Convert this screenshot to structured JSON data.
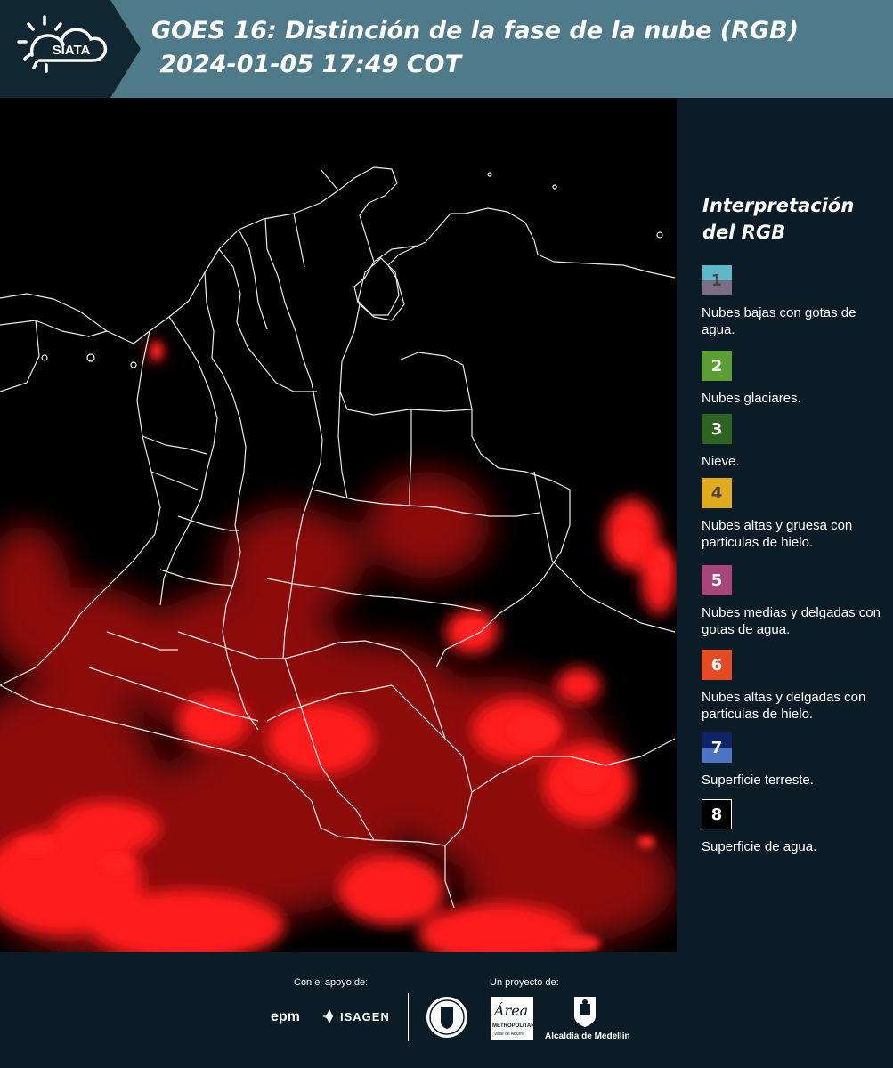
{
  "header": {
    "logo_text": "SIATA",
    "title_line1": "GOES 16: Distinción de la fase de la nube (RGB)",
    "title_line2": " 2024-01-05 17:49 COT",
    "bg_color": "#4e7a8a"
  },
  "legend": {
    "title_line1": "Interpretación",
    "title_line2": "del RGB",
    "items": [
      {
        "num": "1",
        "label": "Nubes bajas con gotas de agua.",
        "color_top": "#5fb8c8",
        "color_bottom": "#7a6e86",
        "num_color": "#444444"
      },
      {
        "num": "2",
        "label": "Nubes glaciares.",
        "color_top": "#5a9e34",
        "color_bottom": "#5a9e34",
        "num_color": "#ffffff"
      },
      {
        "num": "3",
        "label": "Nieve.",
        "color_top": "#2f6321",
        "color_bottom": "#2f6321",
        "num_color": "#ffffff"
      },
      {
        "num": "4",
        "label": "Nubes altas y gruesa con particulas de hielo.",
        "color_top": "#e0ac1c",
        "color_bottom": "#e0ac1c",
        "num_color": "#444444"
      },
      {
        "num": "5",
        "label": "Nubes medias y delgadas con gotas de agua.",
        "color_top": "#a8457a",
        "color_bottom": "#a8457a",
        "num_color": "#ffffff"
      },
      {
        "num": "6",
        "label": "Nubes altas y delgadas con particulas de hielo.",
        "color_top": "#e44a24",
        "color_bottom": "#e44a24",
        "num_color": "#ffffff"
      },
      {
        "num": "7",
        "label": "Superficie terreste.",
        "color_top": "#0f2466",
        "color_bottom": "#4e74c4",
        "num_color": "#ffffff"
      },
      {
        "num": "8",
        "label": "Superficie de agua.",
        "color_top": "#000000",
        "color_bottom": "#000000",
        "num_color": "#ffffff",
        "border": "#ffffff"
      }
    ]
  },
  "footer": {
    "support_label": "Con el apoyo de:",
    "project_label": "Un proyecto de:",
    "sponsor_epm": "epm",
    "sponsor_isagen": "ISAGEN",
    "partner_area_name": "Área",
    "partner_area_sub": "METROPOLITANA",
    "partner_area_sub2": "Valle de Aburrá",
    "partner_alcaldia": "Alcaldía de Medellín"
  }
}
